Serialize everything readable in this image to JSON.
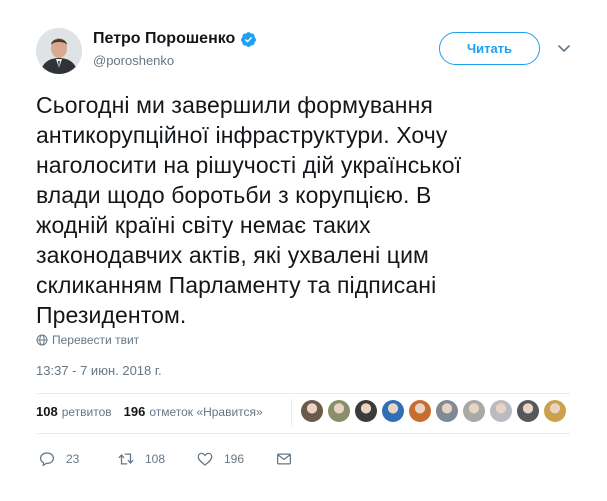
{
  "author": {
    "display_name": "Петро Порошенко",
    "handle": "@poroshenko",
    "verified": true
  },
  "follow_button": {
    "label": "Читать"
  },
  "tweet": {
    "lines": [
      "Сьогодні ми завершили формування",
      "антикорупційної інфраструктури. Хочу",
      "наголосити на рішучості дій української",
      "влади щодо боротьби з корупцією. В",
      "жодній країні світу немає таких",
      "законодавчих актів, які ухвалені цим",
      "скликанням Парламенту та підписані",
      "Президентом."
    ],
    "translate_label": "Перевести твит",
    "timestamp": "13:37 - 7 июн. 2018 г."
  },
  "stats": {
    "retweets_count": "108",
    "retweets_label": "ретвитов",
    "likes_count": "196",
    "likes_label": "отметок «Нравится»"
  },
  "likers": [
    {
      "color": "#6b5a4a"
    },
    {
      "color": "#8a8f6a"
    },
    {
      "color": "#3b3b3b"
    },
    {
      "color": "#2e6fb5"
    },
    {
      "color": "#c76d2f"
    },
    {
      "color": "#7f8a94"
    },
    {
      "color": "#a7aaa6"
    },
    {
      "color": "#b8bcc0"
    },
    {
      "color": "#55585c"
    },
    {
      "color": "#c9a24a"
    }
  ],
  "actions": {
    "reply_count": "23",
    "retweet_count": "108",
    "like_count": "196"
  },
  "colors": {
    "accent": "#1da1f2",
    "text": "#14171a",
    "secondary": "#657786",
    "divider": "#e6ecf0"
  },
  "icons": [
    "verified-badge-icon",
    "chevron-down-icon",
    "globe-icon",
    "reply-icon",
    "retweet-icon",
    "heart-icon",
    "message-icon"
  ]
}
